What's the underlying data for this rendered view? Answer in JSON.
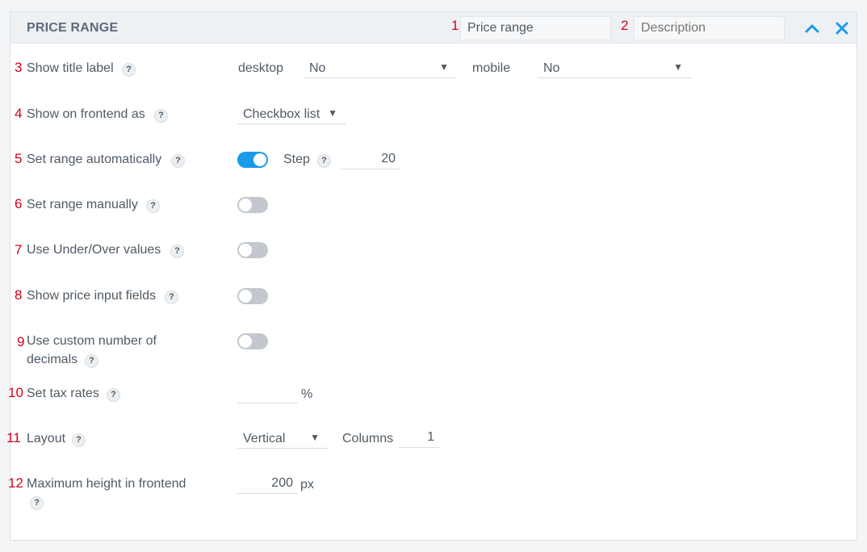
{
  "header": {
    "title": "PRICE RANGE",
    "name_input_value": "Price range",
    "description_placeholder": "Description",
    "collapse_icon": "chevron-up-icon",
    "close_icon": "close-icon",
    "accent_color": "#1a9bea"
  },
  "markers": [
    "1",
    "2",
    "3",
    "4",
    "5",
    "6",
    "7",
    "8",
    "9",
    "10",
    "11",
    "12"
  ],
  "help_glyph": "?",
  "rows": {
    "show_title_label": {
      "label": "Show title label",
      "desktop_label": "desktop",
      "desktop_value": "No",
      "mobile_label": "mobile",
      "mobile_value": "No"
    },
    "show_on_frontend": {
      "label": "Show on frontend as",
      "value": "Checkbox list"
    },
    "set_range_auto": {
      "label": "Set range automatically",
      "toggle": true,
      "step_label": "Step",
      "step_value": "20"
    },
    "set_range_manual": {
      "label": "Set range manually",
      "toggle": false
    },
    "under_over": {
      "label": "Use Under/Over values",
      "toggle": false
    },
    "price_inputs": {
      "label": "Show price input fields",
      "toggle": false
    },
    "custom_decimals": {
      "label_line1": "Use custom number of",
      "label_line2": "decimals",
      "toggle": false
    },
    "tax_rates": {
      "label": "Set tax rates",
      "value": "",
      "unit": "%"
    },
    "layout": {
      "label": "Layout",
      "value": "Vertical",
      "columns_label": "Columns",
      "columns_value": "1"
    },
    "max_height": {
      "label": "Maximum height in frontend",
      "value": "200",
      "unit": "px"
    }
  }
}
